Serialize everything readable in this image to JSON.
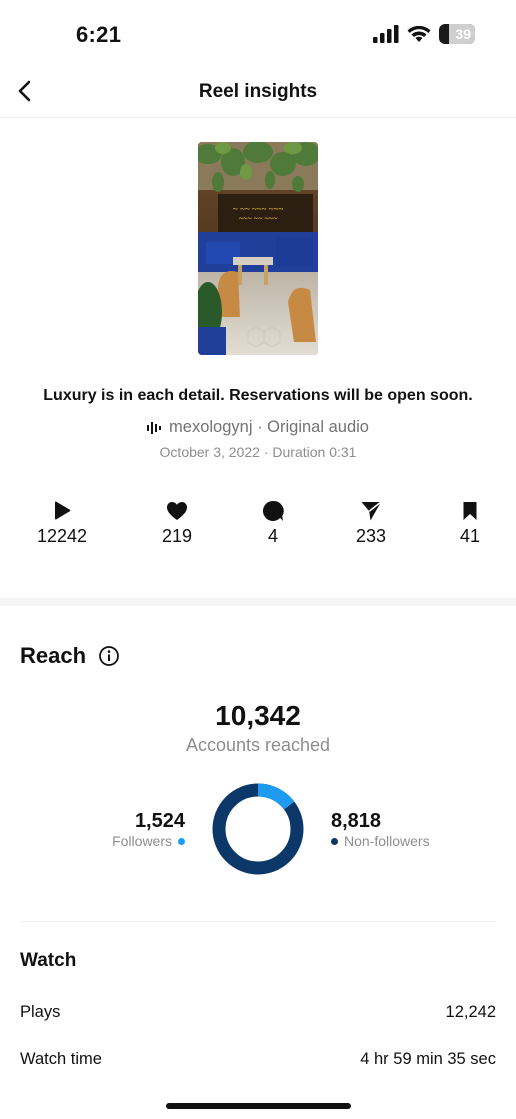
{
  "status_bar": {
    "time": "6:21",
    "battery": "39"
  },
  "nav": {
    "title": "Reel insights"
  },
  "reel": {
    "caption": "Luxury is in each detail. Reservations will be open soon.",
    "audio": "mexologynj · Original audio",
    "meta": "October 3, 2022 · Duration 0:31"
  },
  "stats": {
    "plays": "12242",
    "likes": "219",
    "comments": "4",
    "shares": "233",
    "saves": "41"
  },
  "reach": {
    "title": "Reach",
    "accounts_reached": "10,342",
    "accounts_label": "Accounts reached",
    "followers_count": "1,524",
    "followers_label": "Followers",
    "non_followers_count": "8,818",
    "non_followers_label": "Non-followers",
    "followers_fraction": 0.147,
    "colors": {
      "followers": "#1d9bf0",
      "non_followers": "#0b3769"
    }
  },
  "watch": {
    "title": "Watch",
    "plays_label": "Plays",
    "plays_value": "12,242",
    "watch_time_label": "Watch time",
    "watch_time_value": "4 hr 59 min 35 sec"
  }
}
